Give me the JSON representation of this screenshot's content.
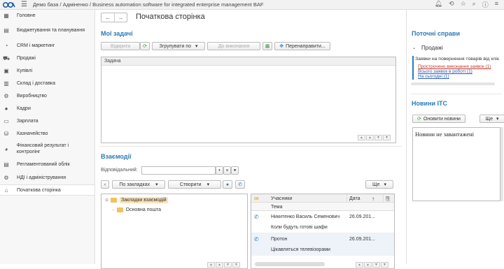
{
  "topbar": {
    "breadcrumb": "Демо база / Адміненко / Business automation software for integrated enterprise management BAF"
  },
  "sidebar": {
    "items": [
      {
        "label": "Головне",
        "icon": "home-grid-icon"
      },
      {
        "label": "Бюджетування та планування",
        "icon": "budget-icon"
      },
      {
        "label": "CRM і маркетинг",
        "icon": "crm-icon"
      },
      {
        "label": "Продажі",
        "icon": "cart-icon"
      },
      {
        "label": "Купівлі",
        "icon": "purchase-icon"
      },
      {
        "label": "Склад і доставка",
        "icon": "warehouse-icon"
      },
      {
        "label": "Виробництво",
        "icon": "production-icon"
      },
      {
        "label": "Кадри",
        "icon": "person-icon"
      },
      {
        "label": "Зарплата",
        "icon": "salary-icon"
      },
      {
        "label": "Казначейство",
        "icon": "treasury-icon"
      },
      {
        "label": "Фінансовий результат і контролінг",
        "icon": "finance-icon"
      },
      {
        "label": "Регламентований облік",
        "icon": "accounting-icon"
      },
      {
        "label": "НДІ і адміністрування",
        "icon": "gear-icon"
      },
      {
        "label": "Початкова сторінка",
        "icon": "home-icon"
      }
    ]
  },
  "main": {
    "page_title": "Початкова сторінка",
    "tasks": {
      "title": "Мої задачі",
      "open_label": "Відкрити",
      "group_label": "Згрупувати по",
      "todo_label": "До виконання",
      "redirect_label": "Перенаправити...",
      "column": "Задача"
    },
    "interactions": {
      "title": "Взаємодії",
      "responsible_label": "Відповідальний:",
      "bookmarks_label": "По закладках",
      "create_label": "Створити",
      "more_label": "Ще",
      "tree": [
        "Закладки взаємодій",
        "Основна пошта"
      ],
      "columns": {
        "participants": "Учасники",
        "date": "Дата",
        "topic": "Тема"
      },
      "rows": [
        {
          "participant": "Никитенко Василь Семенович",
          "date": "26.09.201...",
          "topic": "Коли будуть готові шафи"
        },
        {
          "participant": "Протон",
          "date": "26.09.201...",
          "topic": "Цікавляться телевізорами"
        }
      ]
    }
  },
  "right": {
    "current": {
      "title": "Поточні справи",
      "group": "Продажі",
      "heading": "Заявки на повернення товарів від кліє",
      "links": [
        "Прострочено виконання заявок (1)",
        "Всього заявок в роботі (1)",
        "На сьогодні (1)"
      ]
    },
    "news": {
      "title": "Новини ІТС",
      "refresh_label": "Оновити новини",
      "more_label": "Ще",
      "empty_text": "Новини не завантажені"
    }
  },
  "colors": {
    "accent": "#2a7ab8",
    "overdue": "#c0392b",
    "link": "#2a5db0"
  }
}
